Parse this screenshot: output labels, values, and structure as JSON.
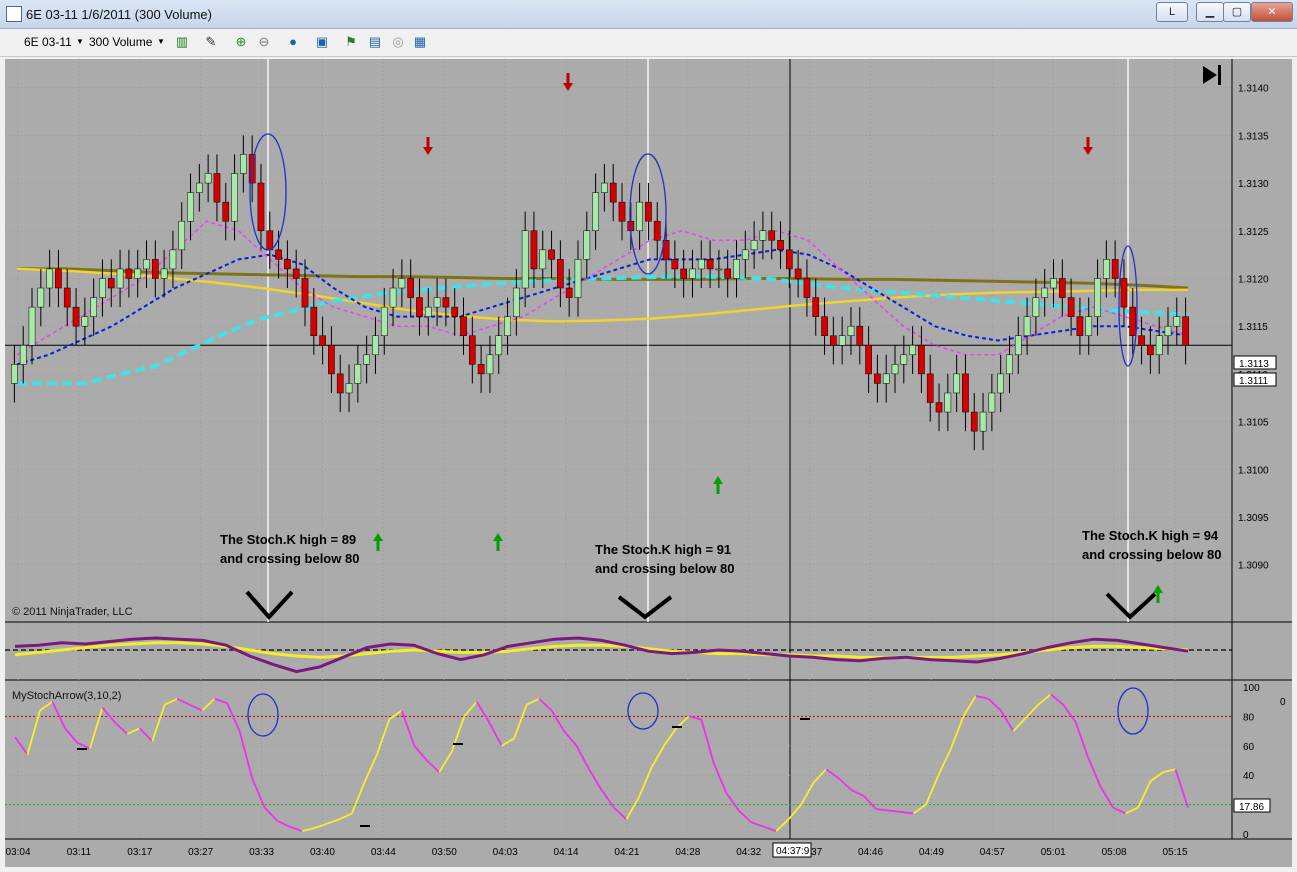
{
  "window": {
    "title": "6E 03-11  1/6/2011 (300 Volume)",
    "btn_l": "L"
  },
  "toolbar": {
    "instrument": "6E 03-11",
    "interval": "300 Volume"
  },
  "chart_data": [
    {
      "type": "candlestick",
      "ylim": [
        1.3084,
        1.3143
      ],
      "ytick_labels": [
        "1.3140",
        "1.3135",
        "1.3130",
        "1.3125",
        "1.3120",
        "1.3115",
        "1.3110",
        "1.3105",
        "1.3100",
        "1.3095",
        "1.3090"
      ],
      "xtick_labels": [
        "03:04",
        "03:11",
        "03:17",
        "03:27",
        "03:33",
        "03:40",
        "03:44",
        "03:50",
        "04:03",
        "04:14",
        "04:21",
        "04:28",
        "04:32",
        "04:37",
        "04:46",
        "04:49",
        "04:57",
        "05:01",
        "05:08",
        "05:15"
      ],
      "price_markers": [
        "1.3113",
        "1.3111"
      ],
      "cursor_time_label": "04:37:9",
      "copyright": "© 2011 NinjaTrader, LLC",
      "annotations": [
        {
          "line1": "The Stoch.K high = 89",
          "line2": "and crossing below 80"
        },
        {
          "line1": "The Stoch.K high = 91",
          "line2": "and crossing below 80"
        },
        {
          "line1": "The Stoch.K high = 94",
          "line2": "and crossing below 80"
        }
      ],
      "closes": [
        1.3111,
        1.3113,
        1.3117,
        1.3119,
        1.3121,
        1.3119,
        1.3117,
        1.3115,
        1.3116,
        1.3118,
        1.312,
        1.3119,
        1.3121,
        1.312,
        1.3121,
        1.3122,
        1.312,
        1.3121,
        1.3123,
        1.3126,
        1.3129,
        1.313,
        1.3131,
        1.3128,
        1.3126,
        1.3131,
        1.3133,
        1.313,
        1.3125,
        1.3123,
        1.3122,
        1.3121,
        1.312,
        1.3117,
        1.3114,
        1.3113,
        1.311,
        1.3108,
        1.3109,
        1.3111,
        1.3112,
        1.3114,
        1.3117,
        1.3119,
        1.312,
        1.3118,
        1.3116,
        1.3117,
        1.3118,
        1.3117,
        1.3116,
        1.3114,
        1.3111,
        1.311,
        1.3112,
        1.3114,
        1.3116,
        1.3119,
        1.3125,
        1.3121,
        1.3123,
        1.3122,
        1.3119,
        1.3118,
        1.3122,
        1.3125,
        1.3129,
        1.313,
        1.3128,
        1.3126,
        1.3125,
        1.3128,
        1.3126,
        1.3124,
        1.3122,
        1.3121,
        1.312,
        1.3121,
        1.3122,
        1.3121,
        1.3121,
        1.312,
        1.3122,
        1.3123,
        1.3124,
        1.3125,
        1.3124,
        1.3123,
        1.3121,
        1.312,
        1.3118,
        1.3116,
        1.3114,
        1.3113,
        1.3114,
        1.3115,
        1.3113,
        1.311,
        1.3109,
        1.311,
        1.3111,
        1.3112,
        1.3113,
        1.311,
        1.3107,
        1.3106,
        1.3108,
        1.311,
        1.3106,
        1.3104,
        1.3106,
        1.3108,
        1.311,
        1.3112,
        1.3114,
        1.3116,
        1.3118,
        1.3119,
        1.312,
        1.3118,
        1.3116,
        1.3114,
        1.3116,
        1.312,
        1.3122,
        1.312,
        1.3117,
        1.3114,
        1.3113,
        1.3112,
        1.3114,
        1.3115,
        1.3116,
        1.3113
      ],
      "series": [
        {
          "name": "olive_ma",
          "values": [
            1.3121,
            1.3121,
            1.31208,
            1.31206,
            1.31205,
            1.31204,
            1.31203,
            1.31202,
            1.31202,
            1.31201,
            1.312,
            1.312,
            1.31199,
            1.31199,
            1.31199,
            1.312,
            1.312,
            1.31199,
            1.31199,
            1.31198,
            1.31197,
            1.31196,
            1.31195,
            1.31193,
            1.3119
          ]
        },
        {
          "name": "yellow_ma",
          "values": [
            1.3121,
            1.31208,
            1.31205,
            1.31201,
            1.31196,
            1.3119,
            1.31183,
            1.31175,
            1.31167,
            1.31161,
            1.31157,
            1.31155,
            1.31156,
            1.31158,
            1.31162,
            1.31167,
            1.31172,
            1.31176,
            1.3118,
            1.31183,
            1.31185,
            1.31186,
            1.31187,
            1.31188,
            1.31188
          ]
        },
        {
          "name": "cyan_ma",
          "values": [
            1.3109,
            1.3109,
            1.3109,
            1.311,
            1.31108,
            1.31125,
            1.31142,
            1.31157,
            1.31166,
            1.31175,
            1.31181,
            1.31186,
            1.31189,
            1.31192,
            1.31195,
            1.31197,
            1.31199,
            1.312,
            1.31201,
            1.31202,
            1.31202,
            1.31201,
            1.31199,
            1.31194,
            1.3119,
            1.31187,
            1.31184,
            1.31181,
            1.31178,
            1.31175,
            1.31172,
            1.31169,
            1.31166,
            1.31164,
            1.31162
          ]
        },
        {
          "name": "blue_ma",
          "values": [
            1.3111,
            1.3112,
            1.31135,
            1.3115,
            1.3117,
            1.3119,
            1.31205,
            1.3122,
            1.31225,
            1.31215,
            1.3119,
            1.3117,
            1.3116,
            1.3116,
            1.3116,
            1.3117,
            1.3118,
            1.3119,
            1.312,
            1.3121,
            1.3122,
            1.3122,
            1.3122,
            1.31225,
            1.3123,
            1.31225,
            1.3121,
            1.3119,
            1.3117,
            1.3115,
            1.3114,
            1.31135,
            1.3114,
            1.31145,
            1.3115,
            1.3115,
            1.31145,
            1.3114
          ]
        },
        {
          "name": "magenta_ma",
          "values": [
            1.3112,
            1.3114,
            1.3116,
            1.3118,
            1.312,
            1.3123,
            1.3126,
            1.3125,
            1.3122,
            1.3119,
            1.3117,
            1.3116,
            1.3115,
            1.3115,
            1.3114,
            1.3115,
            1.3116,
            1.3118,
            1.312,
            1.3122,
            1.3124,
            1.3125,
            1.3124,
            1.3124,
            1.3125,
            1.3124,
            1.3121,
            1.3118,
            1.3115,
            1.3113,
            1.3112,
            1.3112,
            1.3114,
            1.3116,
            1.3117,
            1.3116,
            1.3115,
            1.3114
          ]
        }
      ]
    },
    {
      "type": "line",
      "ylabel_tick": "0",
      "series": [
        {
          "name": "purple_osc",
          "values": [
            3,
            4,
            6,
            5,
            7,
            9,
            10,
            9,
            8,
            4,
            -5,
            -12,
            -18,
            -14,
            -6,
            2,
            5,
            4,
            -3,
            -8,
            -4,
            3,
            6,
            9,
            10,
            8,
            4,
            -1,
            -3,
            -2,
            0,
            -1,
            -3,
            -5,
            -6,
            -8,
            -9,
            -7,
            -6,
            -8,
            -9,
            -10,
            -7,
            -3,
            2,
            6,
            9,
            8,
            5,
            2,
            -1
          ]
        },
        {
          "name": "yellow_osc",
          "values": [
            -4,
            -2,
            0,
            2,
            4,
            5,
            6,
            6,
            5,
            3,
            0,
            -3,
            -5,
            -6,
            -5,
            -3,
            -1,
            0,
            -1,
            -2,
            -2,
            -1,
            1,
            3,
            4,
            4,
            3,
            1,
            -1,
            -2,
            -3,
            -3,
            -4,
            -4,
            -5,
            -5,
            -6,
            -6,
            -6,
            -6,
            -6,
            -5,
            -4,
            -2,
            0,
            2,
            3,
            3,
            2,
            1,
            0
          ]
        }
      ]
    },
    {
      "type": "line",
      "indicator_label": "MyStochArrow(3,10,2)",
      "ylim": [
        0,
        100
      ],
      "ytick_labels": [
        "100",
        "80",
        "60",
        "40",
        "20",
        "0"
      ],
      "current_value": "17.86",
      "values": [
        66,
        54,
        84,
        90,
        72,
        62,
        58,
        86,
        76,
        68,
        72,
        63,
        88,
        92,
        88,
        84,
        92,
        89,
        70,
        38,
        18,
        9,
        5,
        2,
        4,
        7,
        10,
        14,
        35,
        54,
        78,
        84,
        60,
        50,
        42,
        56,
        80,
        90,
        76,
        60,
        65,
        88,
        92,
        84,
        70,
        60,
        44,
        30,
        18,
        10,
        25,
        45,
        60,
        72,
        80,
        78,
        48,
        28,
        16,
        8,
        5,
        2,
        10,
        20,
        35,
        44,
        38,
        30,
        26,
        17,
        16,
        15,
        14,
        20,
        40,
        58,
        80,
        94,
        92,
        84,
        70,
        79,
        88,
        95,
        88,
        76,
        52,
        32,
        18,
        14,
        18,
        36,
        42,
        44,
        17.86
      ]
    }
  ]
}
